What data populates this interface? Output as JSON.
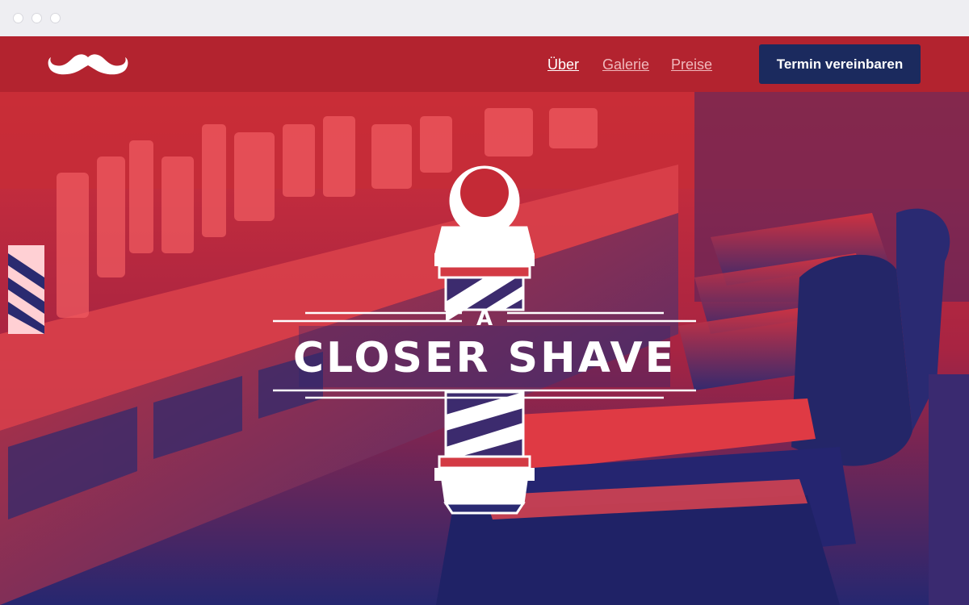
{
  "browser": {
    "window_controls": [
      "close",
      "minimize",
      "maximize"
    ]
  },
  "header": {
    "logo_icon": "mustache-icon",
    "nav": [
      {
        "label": "Über",
        "active": true
      },
      {
        "label": "Galerie",
        "active": false
      },
      {
        "label": "Preise",
        "active": false
      }
    ],
    "cta_label": "Termin vereinbaren"
  },
  "hero": {
    "title_small": "A",
    "title_main": "CLOSER SHAVE",
    "emblem_icon": "barber-pole-icon",
    "background": "barbershop-interior-photo"
  },
  "colors": {
    "header_bg": "#b3232f",
    "cta_bg": "#1b2a5e",
    "nav_active": "#ffffff",
    "nav_inactive": "#f0b8bc",
    "hero_red": "#d62a34",
    "hero_navy": "#23246b"
  }
}
